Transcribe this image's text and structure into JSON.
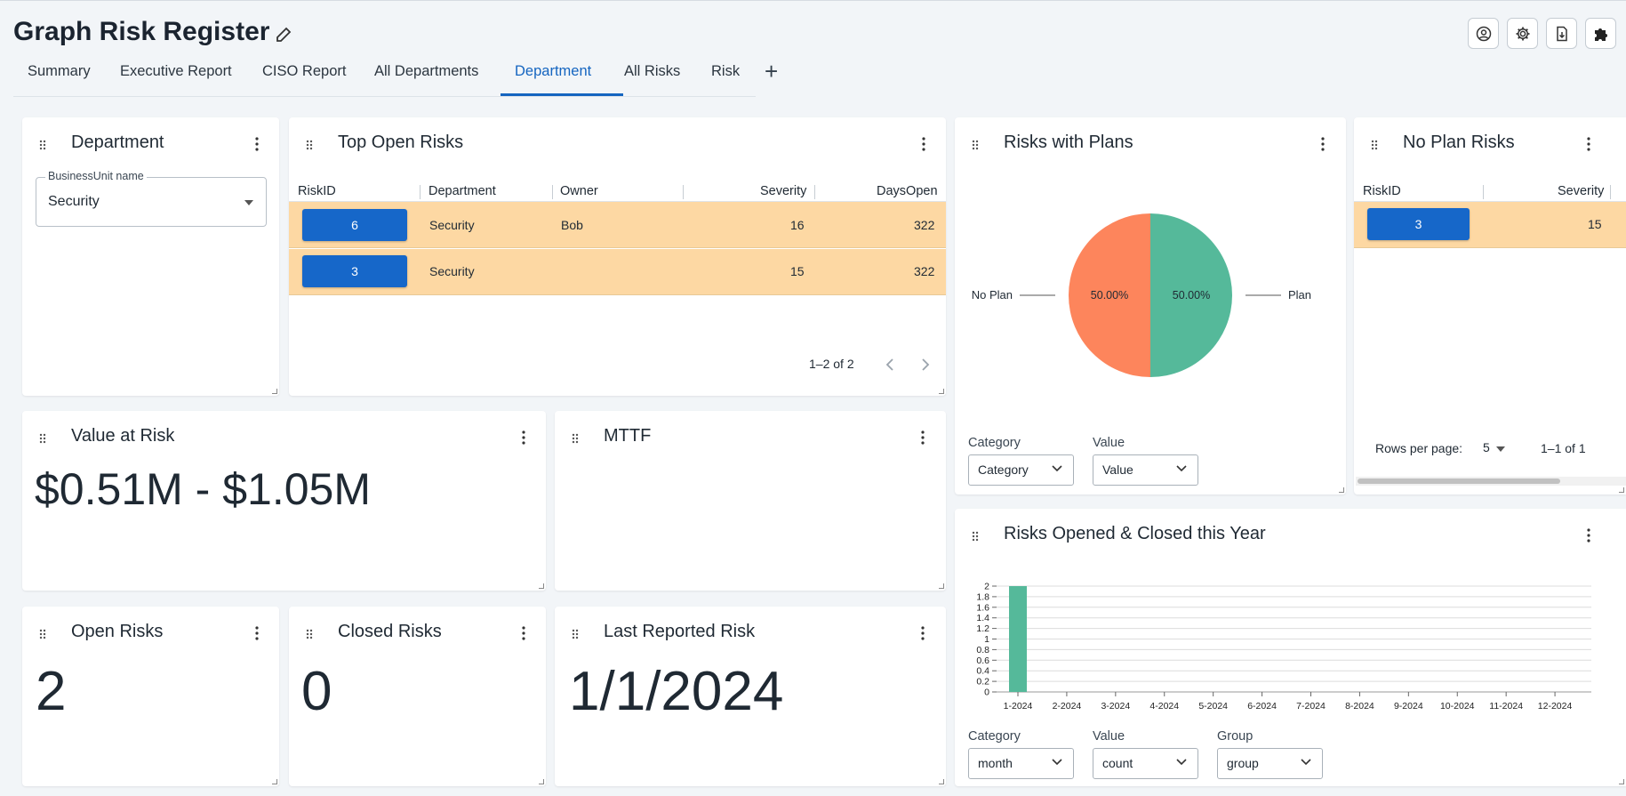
{
  "header": {
    "title": "Graph Risk Register"
  },
  "tabs": [
    {
      "label": "Summary"
    },
    {
      "label": "Executive Report"
    },
    {
      "label": "CISO Report"
    },
    {
      "label": "All Departments"
    },
    {
      "label": "Department"
    },
    {
      "label": "All Risks"
    },
    {
      "label": "Risk"
    }
  ],
  "active_tab": "Department",
  "colors": {
    "accent": "#1565c0",
    "row_highlight": "#fdd8a3",
    "pie_no_plan": "#fd855c",
    "pie_plan": "#55b99a",
    "bar": "#55b99a"
  },
  "department_card": {
    "title": "Department",
    "field_label": "BusinessUnit name",
    "field_value": "Security"
  },
  "top_open_risks": {
    "title": "Top Open Risks",
    "columns": [
      "RiskID",
      "Department",
      "Owner",
      "Severity",
      "DaysOpen"
    ],
    "rows": [
      {
        "id": "6",
        "department": "Security",
        "owner": "Bob",
        "severity": "16",
        "days_open": "322"
      },
      {
        "id": "3",
        "department": "Security",
        "owner": "",
        "severity": "15",
        "days_open": "322"
      }
    ],
    "pagination": "1–2 of 2"
  },
  "risks_with_plans": {
    "title": "Risks with Plans",
    "category_label": "Category",
    "category_value": "Category",
    "value_label": "Value",
    "value_value": "Value"
  },
  "no_plan_risks": {
    "title": "No Plan Risks",
    "columns": [
      "RiskID",
      "Severity"
    ],
    "rows": [
      {
        "id": "3",
        "severity": "15"
      }
    ],
    "rows_per_page_label": "Rows per page:",
    "rows_per_page": "5",
    "pagination": "1–1 of 1"
  },
  "value_at_risk": {
    "title": "Value at Risk",
    "value": "$0.51M - $1.05M"
  },
  "mttf": {
    "title": "MTTF"
  },
  "open_risks": {
    "title": "Open Risks",
    "value": "2"
  },
  "closed_risks": {
    "title": "Closed Risks",
    "value": "0"
  },
  "last_reported": {
    "title": "Last Reported Risk",
    "value": "1/1/2024"
  },
  "opened_closed": {
    "title": "Risks Opened & Closed this Year",
    "category_label": "Category",
    "category_value": "month",
    "value_label": "Value",
    "value_value": "count",
    "group_label": "Group",
    "group_value": "group"
  },
  "chart_data": [
    {
      "type": "pie",
      "labels": [
        "No Plan",
        "Plan"
      ],
      "values": [
        50,
        50
      ],
      "value_labels": [
        "50.00%",
        "50.00%"
      ]
    },
    {
      "type": "bar",
      "categories": [
        "1-2024",
        "2-2024",
        "3-2024",
        "4-2024",
        "5-2024",
        "6-2024",
        "7-2024",
        "8-2024",
        "9-2024",
        "10-2024",
        "11-2024",
        "12-2024"
      ],
      "values": [
        2,
        0,
        0,
        0,
        0,
        0,
        0,
        0,
        0,
        0,
        0,
        0
      ],
      "ylim": [
        0,
        2
      ],
      "yticks": [
        "0",
        "0.2",
        "0.4",
        "0.6",
        "0.8",
        "1",
        "1.2",
        "1.4",
        "1.6",
        "1.8",
        "2"
      ],
      "grid": true
    }
  ]
}
